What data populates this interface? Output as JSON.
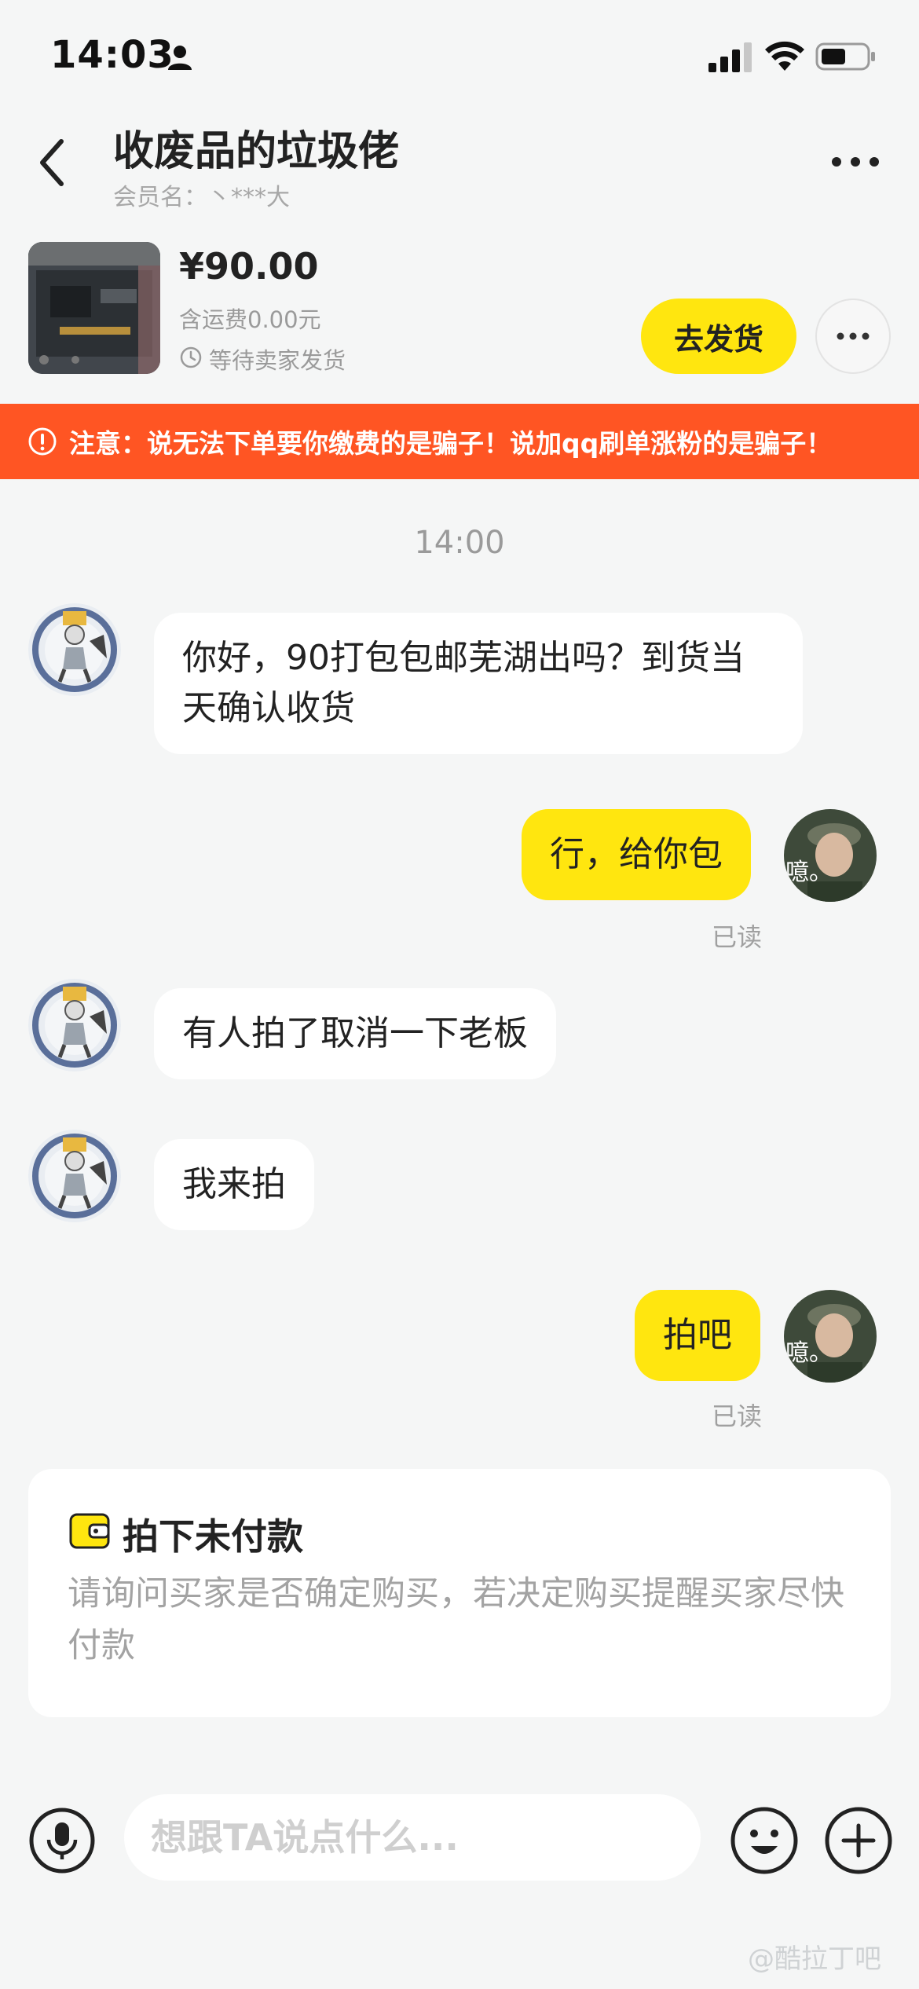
{
  "status_bar": {
    "time": "14:03"
  },
  "header": {
    "title": "收废品的垃圾佬",
    "member_name": "会员名：丶***大"
  },
  "product": {
    "price": "¥90.00",
    "shipping": "含运费0.00元",
    "status": "等待卖家发货",
    "ship_button": "去发货"
  },
  "warning": {
    "text": "注意：说无法下单要你缴费的是骗子！说加qq刷单涨粉的是骗子！"
  },
  "messages": {
    "time_divider": "14:00",
    "m1": "你好，90打包包邮芜湖出吗？到货当天确认收货",
    "m2": "行，给你包",
    "m2_read": "已读",
    "m3": "有人拍了取消一下老板",
    "m4": "我来拍",
    "m5": "拍吧",
    "m5_read": "已读"
  },
  "system_card": {
    "title": "拍下未付款",
    "description": "请询问买家是否确定购买，若决定购买提醒买家尽快付款"
  },
  "input_bar": {
    "placeholder": "想跟TA说点什么...",
    "watermark": "@酷拉丁吧"
  },
  "colors": {
    "accent_yellow": "#ffe60f",
    "warning_orange": "#ff5523",
    "background": "#f5f6f6"
  }
}
